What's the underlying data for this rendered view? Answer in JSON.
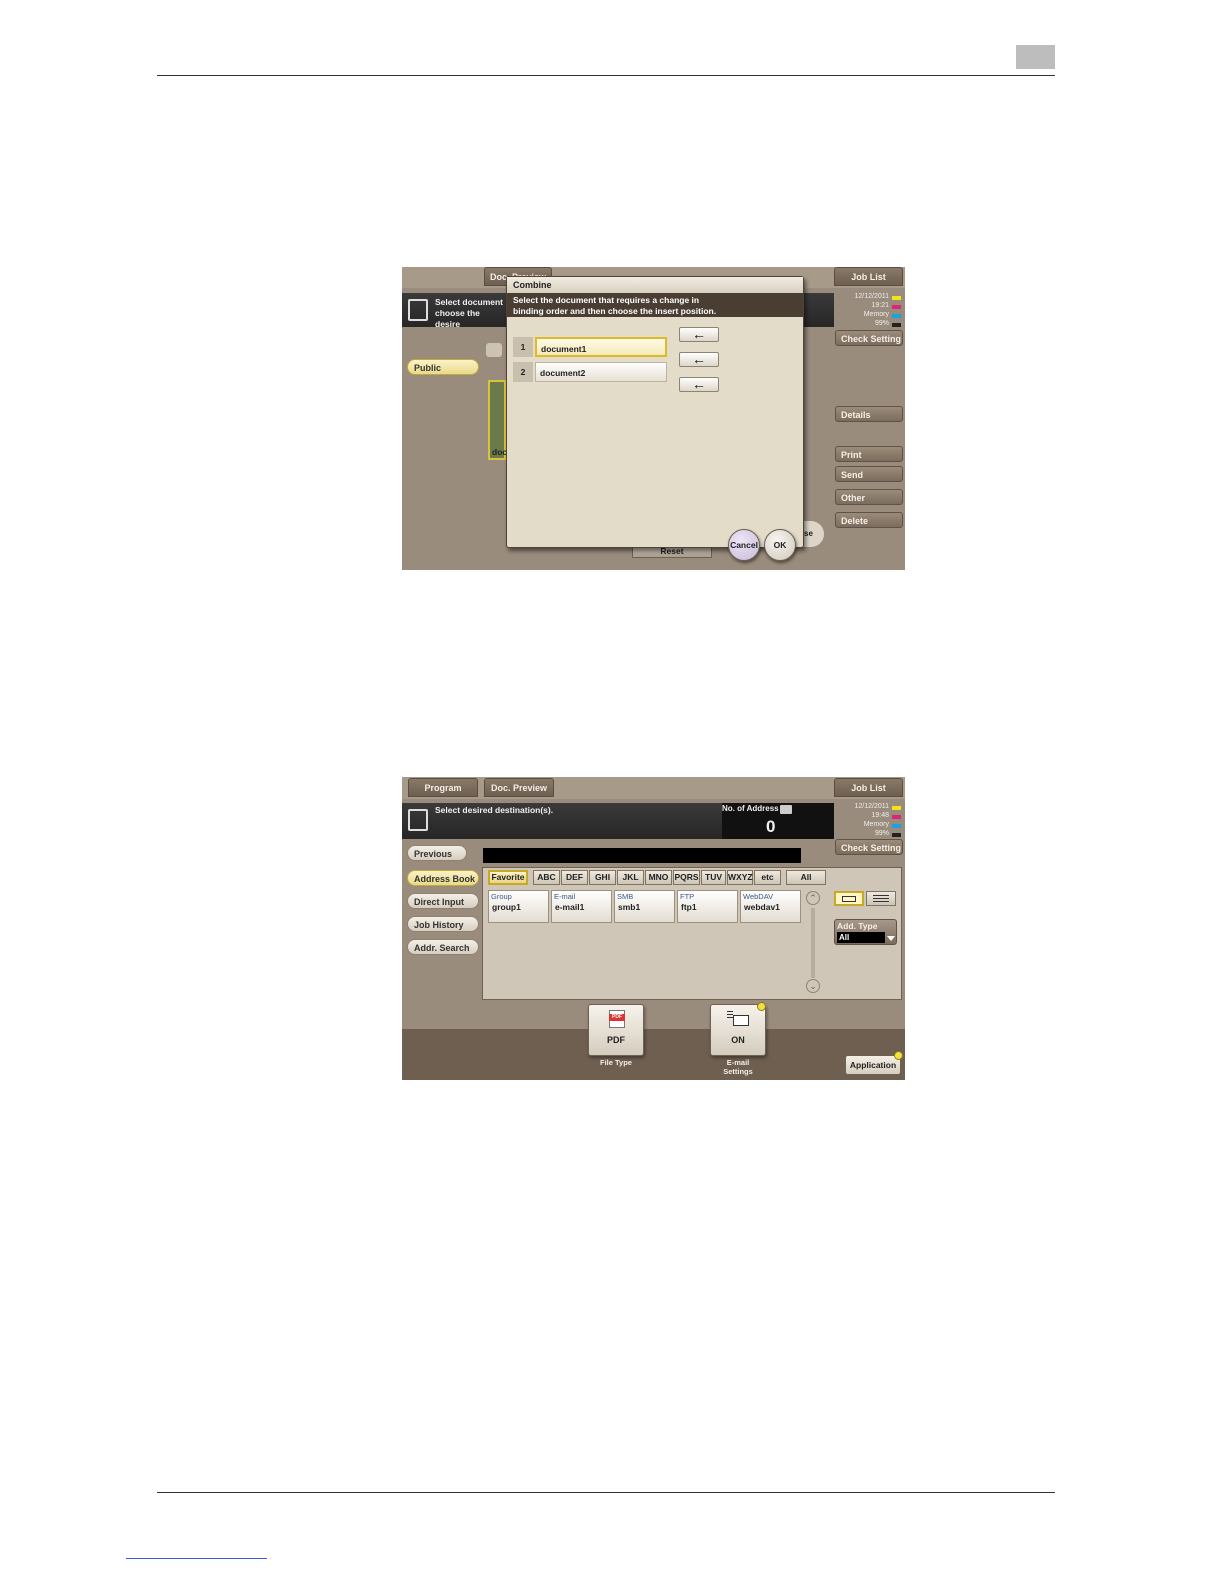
{
  "screen1": {
    "tab_doc_preview": "Doc. Preview",
    "tab_job_list": "Job List",
    "message": "Select document choose the desire",
    "status_date": "12/12/2011",
    "status_time": "19:21",
    "status_memory_label": "Memory",
    "status_memory_value": "99%",
    "check_setting": "Check Setting",
    "public": "Public",
    "thumb_label": "doc",
    "right_buttons": [
      "Details",
      "Print",
      "Send",
      "Other",
      "Delete"
    ],
    "reset": "Reset",
    "close_fragment": "se",
    "dialog": {
      "title": "Combine",
      "message_line1": "Select the document that requires a change in",
      "message_line2": "binding order and  then choose the insert position.",
      "documents": [
        {
          "num": "1",
          "name": "document1"
        },
        {
          "num": "2",
          "name": "document2"
        }
      ],
      "arrow": "←",
      "cancel": "Cancel",
      "ok": "OK"
    }
  },
  "screen2": {
    "tab_program": "Program",
    "tab_doc_preview": "Doc. Preview",
    "tab_job_list": "Job List",
    "message": "Select desired destination(s).",
    "no_address_label": "No. of Address",
    "no_address_value": "0",
    "status_date": "12/12/2011",
    "status_time": "19:48",
    "status_memory_label": "Memory",
    "status_memory_value": "99%",
    "check_setting": "Check Setting",
    "previous": "Previous",
    "nav": [
      "Address Book",
      "Direct Input",
      "Job History",
      "Addr. Search"
    ],
    "alpha_tabs": [
      "Favorite",
      "ABC",
      "DEF",
      "GHI",
      "JKL",
      "MNO",
      "PQRS",
      "TUV",
      "WXYZ",
      "etc",
      "All"
    ],
    "destinations": [
      {
        "type": "Group",
        "name": "group1"
      },
      {
        "type": "E-mail",
        "name": "e-mail1"
      },
      {
        "type": "SMB",
        "name": "smb1"
      },
      {
        "type": "FTP",
        "name": "ftp1"
      },
      {
        "type": "WebDAV",
        "name": "webdav1"
      }
    ],
    "add_type_label": "Add. Type",
    "add_type_value": "All",
    "file_type_icon_text": "PDF",
    "file_type_value": "PDF",
    "file_type_caption": "File Type",
    "email_settings_value": "ON",
    "email_settings_caption1": "E-mail",
    "email_settings_caption2": "Settings",
    "application": "Application"
  },
  "colors": {
    "toner_y": "#f2e21a",
    "toner_m": "#e0247a",
    "toner_c": "#1aa3e0",
    "toner_k": "#222222"
  }
}
